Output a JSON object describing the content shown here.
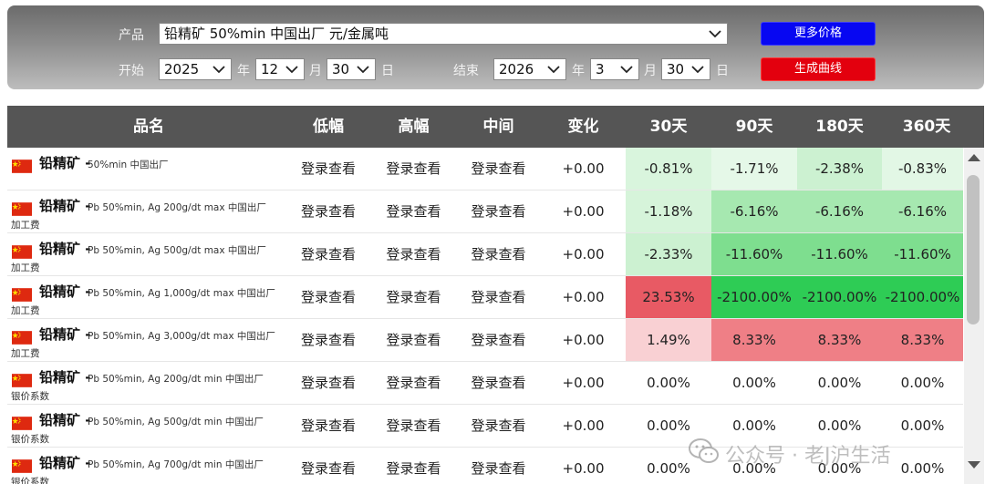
{
  "filter": {
    "product_label": "产品",
    "product_value": "铅精矿 50%min 中国出厂 元/金属吨",
    "start_label": "开始",
    "start_year": "2025",
    "start_month": "12",
    "start_day": "30",
    "end_label": "结束",
    "end_year": "2026",
    "end_month": "3",
    "end_day": "30",
    "year_unit": "年",
    "month_unit": "月",
    "day_unit": "日",
    "more_prices_button": "更多价格",
    "generate_curve_button": "生成曲线"
  },
  "table": {
    "headers": [
      "品名",
      "低幅",
      "高幅",
      "中间",
      "变化",
      "30天",
      "90天",
      "180天",
      "360天"
    ],
    "rows": [
      {
        "name": "铅精矿",
        "spec": "50%min 中国出厂",
        "sub": "",
        "low": "登录查看",
        "high": "登录查看",
        "mid": "登录查看",
        "change": "+0.00",
        "d30": "-0.81%",
        "d90": "-1.71%",
        "d180": "-2.38%",
        "d360": "-0.83%",
        "c30": "#d9f5dd",
        "c90": "#e5f8e8",
        "c180": "#ccf1d1",
        "c360": "#e2f7e5"
      },
      {
        "name": "铅精矿",
        "spec": "Pb 50%min, Ag 200g/dt max 中国出厂",
        "sub": "加工费",
        "low": "登录查看",
        "high": "登录查看",
        "mid": "登录查看",
        "change": "+0.00",
        "d30": "-1.18%",
        "d90": "-6.16%",
        "d180": "-6.16%",
        "d360": "-6.16%",
        "c30": "#d6f4da",
        "c90": "#a6e8b0",
        "c180": "#a6e8b0",
        "c360": "#a6e8b0"
      },
      {
        "name": "铅精矿",
        "spec": "Pb 50%min, Ag 500g/dt max 中国出厂",
        "sub": "加工费",
        "low": "登录查看",
        "high": "登录查看",
        "mid": "登录查看",
        "change": "+0.00",
        "d30": "-2.33%",
        "d90": "-11.60%",
        "d180": "-11.60%",
        "d360": "-11.60%",
        "c30": "#ccf1d1",
        "c90": "#7ede8f",
        "c180": "#7ede8f",
        "c360": "#7ede8f"
      },
      {
        "name": "铅精矿",
        "spec": "Pb 50%min, Ag 1,000g/dt max 中国出厂",
        "sub": "加工费",
        "low": "登录查看",
        "high": "登录查看",
        "mid": "登录查看",
        "change": "+0.00",
        "d30": "23.53%",
        "d90": "-2100.00%",
        "d180": "-2100.00%",
        "d360": "-2100.00%",
        "c30": "#e85a64",
        "c90": "#2ecc55",
        "c180": "#2ecc55",
        "c360": "#2ecc55"
      },
      {
        "name": "铅精矿",
        "spec": "Pb 50%min, Ag 3,000g/dt max 中国出厂",
        "sub": "加工费",
        "low": "登录查看",
        "high": "登录查看",
        "mid": "登录查看",
        "change": "+0.00",
        "d30": "1.49%",
        "d90": "8.33%",
        "d180": "8.33%",
        "d360": "8.33%",
        "c30": "#f9d0d3",
        "c90": "#ef7f86",
        "c180": "#ef7f86",
        "c360": "#ef7f86"
      },
      {
        "name": "铅精矿",
        "spec": "Pb 50%min, Ag 200g/dt min 中国出厂",
        "sub": "银价系数",
        "low": "登录查看",
        "high": "登录查看",
        "mid": "登录查看",
        "change": "+0.00",
        "d30": "0.00%",
        "d90": "0.00%",
        "d180": "0.00%",
        "d360": "0.00%",
        "c30": "#ffffff",
        "c90": "#ffffff",
        "c180": "#ffffff",
        "c360": "#ffffff"
      },
      {
        "name": "铅精矿",
        "spec": "Pb 50%min, Ag 500g/dt min 中国出厂",
        "sub": "银价系数",
        "low": "登录查看",
        "high": "登录查看",
        "mid": "登录查看",
        "change": "+0.00",
        "d30": "0.00%",
        "d90": "0.00%",
        "d180": "0.00%",
        "d360": "0.00%",
        "c30": "#ffffff",
        "c90": "#ffffff",
        "c180": "#ffffff",
        "c360": "#ffffff"
      },
      {
        "name": "铅精矿",
        "spec": "Pb 50%min, Ag 700g/dt min 中国出厂",
        "sub": "银价系数",
        "low": "登录查看",
        "high": "登录查看",
        "mid": "登录查看",
        "change": "+0.00",
        "d30": "0.00%",
        "d90": "0.00%",
        "d180": "0.00%",
        "d360": "0.00%",
        "c30": "#ffffff",
        "c90": "#ffffff",
        "c180": "#ffffff",
        "c360": "#ffffff"
      }
    ]
  },
  "watermark": {
    "icon": "wechat-icon",
    "text": "公众号 · 老J沪生活"
  },
  "colors": {
    "header_bg": "#555555",
    "more_prices": "#0707f2",
    "generate_curve": "#e3000e",
    "flag_red": "#de2910",
    "flag_star": "#ffde00"
  }
}
